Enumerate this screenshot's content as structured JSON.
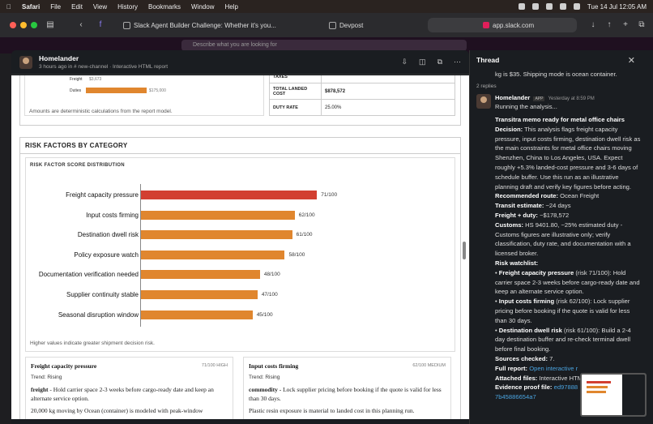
{
  "menubar": {
    "app": "Safari",
    "items": [
      "File",
      "Edit",
      "View",
      "History",
      "Bookmarks",
      "Window",
      "Help"
    ],
    "clock": "Tue 14 Jul  12:05 AM"
  },
  "browser": {
    "tab1": "Slack Agent Builder Challenge: Whether it's you...",
    "tab2": "Devpost",
    "url": "app.slack.com",
    "search_placeholder": "Describe what you are looking for"
  },
  "panel": {
    "title": "Homelander",
    "subtitle": "3 hours ago in # new-channel  · Interactive HTML report"
  },
  "report": {
    "freight_label": "Freight",
    "freight_value": "$3,673",
    "duties_label": "Duties",
    "duties_value": "$175,000",
    "note": "Amounts are deterministic calculations from the report model.",
    "cost_rows": [
      {
        "label": "TAXES",
        "value": ""
      },
      {
        "label": "TOTAL LANDED COST",
        "value": "$878,572"
      },
      {
        "label": "DUTY RATE",
        "value": "25.00%"
      }
    ],
    "section_title": "RISK FACTORS BY CATEGORY",
    "chart_note": "Higher values indicate greater shipment decision risk.",
    "cards": [
      {
        "title": "Freight capacity pressure",
        "score": "71/100 HIGH",
        "trend": "Trend: Rising",
        "p1_bold": "freight",
        "p1": " - Hold carrier space 2-3 weeks before cargo-ready date and keep an alternate service option.",
        "p2": "20,000 kg moving by Ocean (container) is modeled with peak-window"
      },
      {
        "title": "Input costs firming",
        "score": "62/100 MEDIUM",
        "trend": "Trend: Rising",
        "p1_bold": "commodity",
        "p1": " - Lock supplier pricing before booking if the quote is valid for less than 30 days.",
        "p2": "Plastic resin exposure is material to landed cost in this planning run."
      }
    ]
  },
  "chart_data": {
    "type": "bar",
    "title": "RISK FACTOR SCORE DISTRIBUTION",
    "orientation": "horizontal",
    "categories": [
      "Freight capacity pressure",
      "Input costs firming",
      "Destination dwell risk",
      "Policy exposure watch",
      "Documentation verification needed",
      "Supplier continuity stable",
      "Seasonal disruption window"
    ],
    "values": [
      71,
      62,
      61,
      58,
      48,
      47,
      45
    ],
    "value_labels": [
      "71/100",
      "62/100",
      "61/100",
      "58/100",
      "48/100",
      "47/100",
      "45/100"
    ],
    "xlim": [
      0,
      100
    ],
    "colors": [
      "#d23f31",
      "#e0862e",
      "#e0862e",
      "#e0862e",
      "#e0862e",
      "#e0862e",
      "#e0862e"
    ],
    "grid": false
  },
  "thread": {
    "title": "Thread",
    "prev_line": "kg is $35. Shipping mode is ocean container.",
    "replies": "2 replies",
    "author": "Homelander",
    "app_badge": "APP",
    "time": "Yesterday at 8:59 PM",
    "running": "Running the analysis...",
    "memo_title": "Transitra memo ready for metal office chairs",
    "decision_label": "Decision:",
    "decision": " This analysis flags freight capacity pressure, input costs firming, destination dwell risk as the main constraints for metal office chairs moving Shenzhen, China to Los Angeles, USA. Expect roughly +5.3% landed-cost pressure and 3-6 days of schedule buffer. Use this run as an illustrative planning draft and verify key figures before acting.",
    "route_label": "Recommended route:",
    "route": " Ocean Freight",
    "transit_label": "Transit estimate:",
    "transit": " ~24 days",
    "fd_label": "Freight + duty:",
    "fd": " ~$178,572",
    "customs_label": "Customs:",
    "customs": " HS 9401.80, ~25% estimated duty - Customs figures are illustrative only; verify classification, duty rate, and documentation with a licensed broker.",
    "watch_label": "Risk watchlist:",
    "w1_label": "Freight capacity pressure",
    "w1": " (risk 71/100): Hold carrier space 2-3 weeks before cargo-ready date and keep an alternate service option.",
    "w2_label": "Input costs firming",
    "w2": " (risk 62/100): Lock supplier pricing before booking if the quote is valid for less than 30 days.",
    "w3_label": "Destination dwell risk",
    "w3": " (risk 61/100): Build a 2-4 day destination buffer and re-check terminal dwell before final booking.",
    "sources_label": "Sources checked:",
    "sources": " 7.",
    "report_label": "Full report:",
    "report_link": "Open interactive r",
    "attached_label": "Attached files:",
    "attached": " Interactive HTM",
    "proof_label": "Evidence proof file:",
    "proof_link": "ed97888",
    "proof_hash": "7b45886654a7"
  }
}
